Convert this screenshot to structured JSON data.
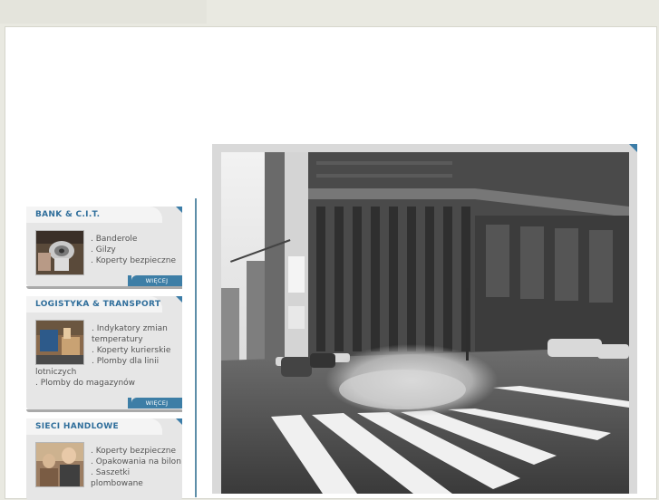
{
  "categories": [
    {
      "title": "BANK & C.I.T.",
      "items": [
        ". Banderole",
        ". Gilzy",
        ". Koperty bezpieczne"
      ],
      "more_label": "WIĘCEJ",
      "thumb_icon": "roll-photo-icon"
    },
    {
      "title": "LOGISTYKA & TRANSPORT",
      "items": [
        ". Indykatory zmian",
        "temperatury",
        ". Koperty kurierskie",
        ". Plomby dla linii",
        "lotniczych",
        ". Plomby do magazynów"
      ],
      "more_label": "WIĘCEJ",
      "thumb_icon": "warehouse-photo-icon"
    },
    {
      "title": "SIECI HANDLOWE",
      "items": [
        ". Koperty bezpieczne",
        ". Opakowania na bilon",
        ". Saszetki",
        "plombowane"
      ],
      "more_label": "",
      "thumb_icon": "retail-photo-icon"
    }
  ],
  "hero_image": "city-street-photo",
  "colors": {
    "accent": "#3d7ea6",
    "title": "#2f6e9b",
    "background": "#e9e9e1"
  }
}
